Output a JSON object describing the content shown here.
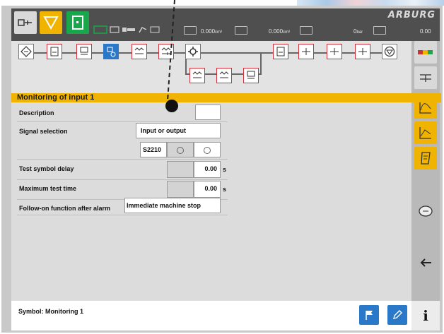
{
  "brand": "ARBURG",
  "statusbar": {
    "values": [
      "0.000",
      "0.000",
      "0",
      "0.00"
    ],
    "units": [
      "cm³",
      "cm³",
      "bar",
      ""
    ]
  },
  "panel": {
    "title": "Monitoring of input 1",
    "rows": {
      "description": {
        "label": "Description",
        "value": ""
      },
      "signal": {
        "label": "Signal selection",
        "value": "Input or output"
      },
      "signal_code": {
        "value": "S2210"
      },
      "delay": {
        "label": "Test symbol delay",
        "value": "0.00",
        "unit": "s"
      },
      "max_test": {
        "label": "Maximum test time",
        "value": "0.00",
        "unit": "s"
      },
      "follow_on": {
        "label": "Follow-on function after alarm",
        "value": "Immediate machine stop"
      }
    }
  },
  "bottom": {
    "symbol_label": "Symbol: Monitoring 1"
  },
  "info_label": "i",
  "colors": {
    "accent": "#f0b400",
    "blue": "#2a78c8",
    "green": "#1aa64a",
    "alarm_red": "#d0303a"
  }
}
